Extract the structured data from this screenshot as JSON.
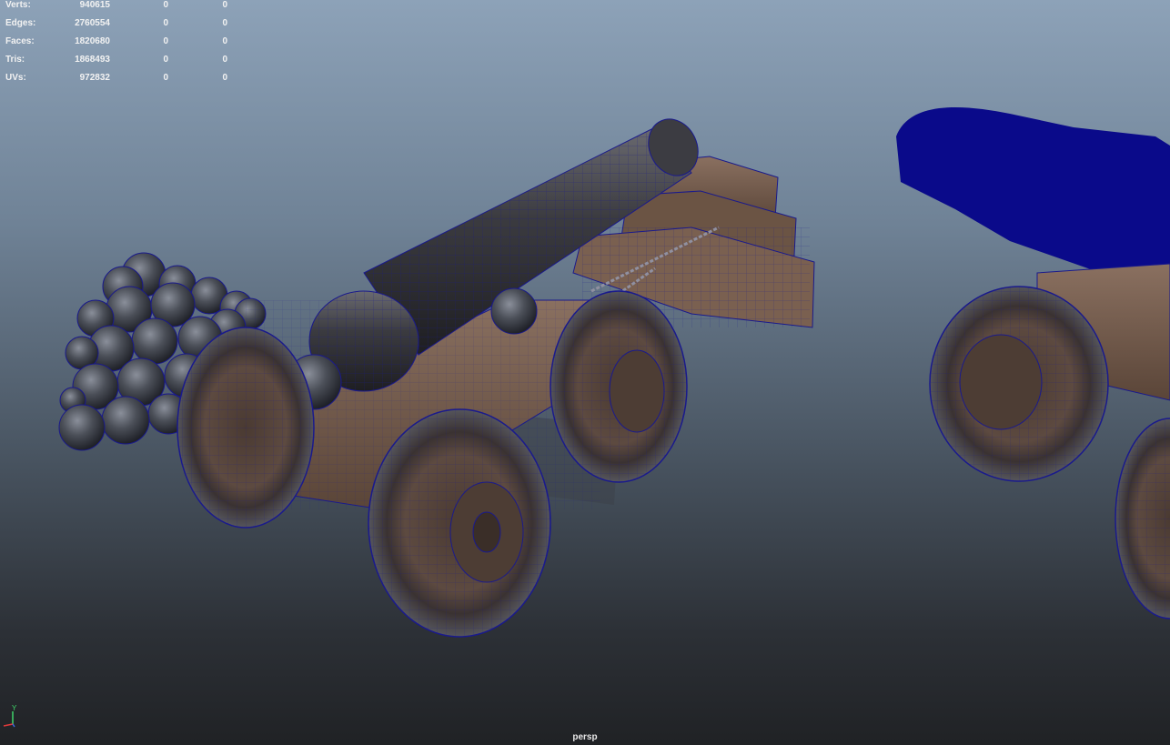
{
  "hud": {
    "rows": [
      {
        "label": "Verts:",
        "total": "940615",
        "selected": "0",
        "component": "0"
      },
      {
        "label": "Edges:",
        "total": "2760554",
        "selected": "0",
        "component": "0"
      },
      {
        "label": "Faces:",
        "total": "1820680",
        "selected": "0",
        "component": "0"
      },
      {
        "label": "Tris:",
        "total": "1868493",
        "selected": "0",
        "component": "0"
      },
      {
        "label": "UVs:",
        "total": "972832",
        "selected": "0",
        "component": "0"
      }
    ]
  },
  "axis": {
    "y_label": "Y"
  },
  "viewport": {
    "camera_label": "persp"
  },
  "colors": {
    "wireframe": "#1a1a8c",
    "wood": "#6b5444",
    "metal": "#4a4a4e",
    "selected_mesh": "#0a0a8a"
  }
}
